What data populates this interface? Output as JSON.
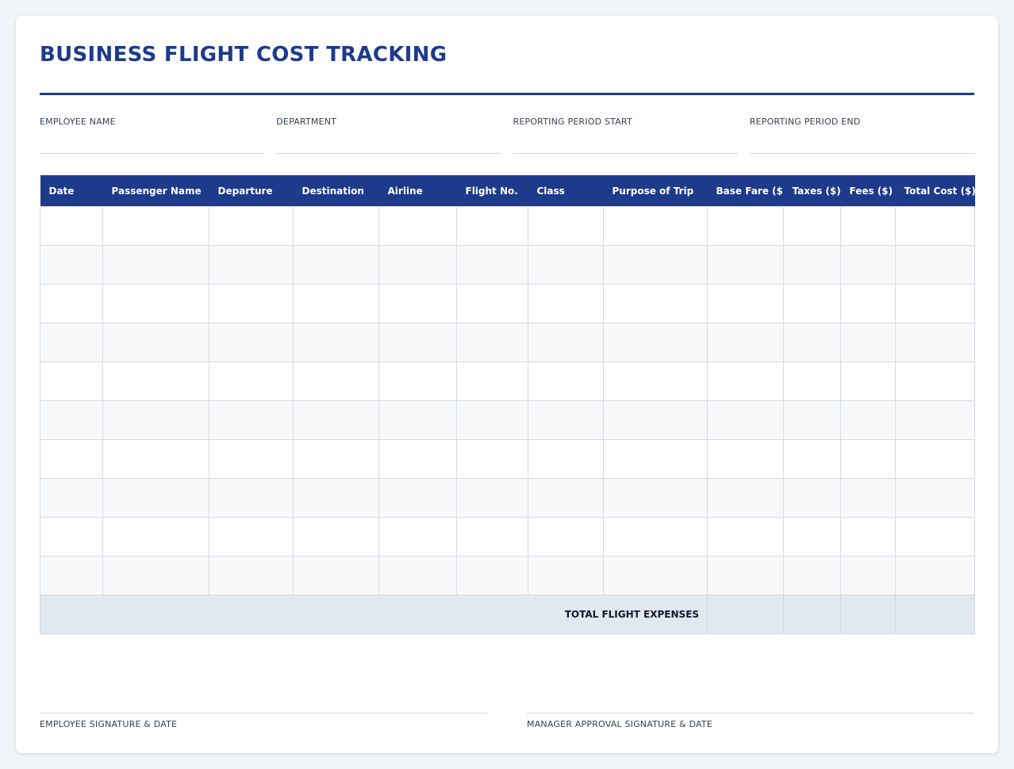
{
  "title": "BUSINESS FLIGHT COST TRACKING",
  "colors": {
    "accent": "#1e3a8a",
    "total_row": "#e2e8f0",
    "stripe": "#f7f9fb"
  },
  "fields": [
    {
      "label": "EMPLOYEE NAME",
      "value": ""
    },
    {
      "label": "DEPARTMENT",
      "value": ""
    },
    {
      "label": "REPORTING PERIOD START",
      "value": ""
    },
    {
      "label": "REPORTING PERIOD END",
      "value": ""
    }
  ],
  "table": {
    "columns": [
      "Date",
      "Passenger Name",
      "Departure",
      "Destination",
      "Airline",
      "Flight No.",
      "Class",
      "Purpose of Trip",
      "Base Fare ($)",
      "Taxes ($)",
      "Fees ($)",
      "Total Cost ($)"
    ],
    "rows": [
      [
        "",
        "",
        "",
        "",
        "",
        "",
        "",
        "",
        "",
        "",
        "",
        ""
      ],
      [
        "",
        "",
        "",
        "",
        "",
        "",
        "",
        "",
        "",
        "",
        "",
        ""
      ],
      [
        "",
        "",
        "",
        "",
        "",
        "",
        "",
        "",
        "",
        "",
        "",
        ""
      ],
      [
        "",
        "",
        "",
        "",
        "",
        "",
        "",
        "",
        "",
        "",
        "",
        ""
      ],
      [
        "",
        "",
        "",
        "",
        "",
        "",
        "",
        "",
        "",
        "",
        "",
        ""
      ],
      [
        "",
        "",
        "",
        "",
        "",
        "",
        "",
        "",
        "",
        "",
        "",
        ""
      ],
      [
        "",
        "",
        "",
        "",
        "",
        "",
        "",
        "",
        "",
        "",
        "",
        ""
      ],
      [
        "",
        "",
        "",
        "",
        "",
        "",
        "",
        "",
        "",
        "",
        "",
        ""
      ],
      [
        "",
        "",
        "",
        "",
        "",
        "",
        "",
        "",
        "",
        "",
        "",
        ""
      ],
      [
        "",
        "",
        "",
        "",
        "",
        "",
        "",
        "",
        "",
        "",
        "",
        ""
      ]
    ],
    "total_label": "TOTAL FLIGHT EXPENSES",
    "totals": {
      "base_fare": "",
      "taxes": "",
      "fees": "",
      "total_cost": ""
    }
  },
  "signatures": {
    "employee": "EMPLOYEE SIGNATURE & DATE",
    "manager": "MANAGER APPROVAL SIGNATURE & DATE"
  }
}
